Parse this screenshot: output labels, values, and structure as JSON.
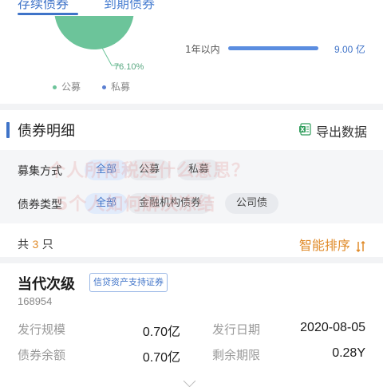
{
  "tabs": {
    "active": "存续债券",
    "other": "到期债券"
  },
  "pie": {
    "public_pct_label": "76.10%",
    "public_share": 0.761,
    "colors": {
      "public": "#6cc49a",
      "private": "#5b7fd1"
    },
    "legend": {
      "public": "公募",
      "private": "私募"
    }
  },
  "maturity_bar": {
    "label": "1年以内",
    "value": "9.00 亿",
    "fill_fraction": 1.0,
    "color": "#5b8de0"
  },
  "section": {
    "title": "债券明细",
    "export_label": "导出数据",
    "icon": "excel-icon"
  },
  "filters": {
    "raise_method": {
      "label": "募集方式",
      "options": [
        "全部",
        "公募",
        "私募"
      ],
      "selected": "全部"
    },
    "bond_type": {
      "label": "债券类型",
      "options": [
        "全部",
        "金融机构债券",
        "公司债"
      ],
      "selected": "全部"
    }
  },
  "watermark": {
    "line1": "个人所得税是什么意思？",
    "line2": "5个人如何解决冻结"
  },
  "summary": {
    "prefix": "共",
    "count": "3",
    "suffix": "只",
    "sort_label": "智能排序"
  },
  "bond": {
    "name": "当代次级",
    "tag": "信贷资产支持证券",
    "code": "168954",
    "issue_size_label": "发行规模",
    "issue_size": "0.70亿",
    "issue_date_label": "发行日期",
    "issue_date": "2020-08-05",
    "balance_label": "债券余额",
    "balance": "0.70亿",
    "remaining_label": "剩余期限",
    "remaining": "0.28Y"
  },
  "accent": "#3f73c8",
  "orange": "#e08b2a"
}
